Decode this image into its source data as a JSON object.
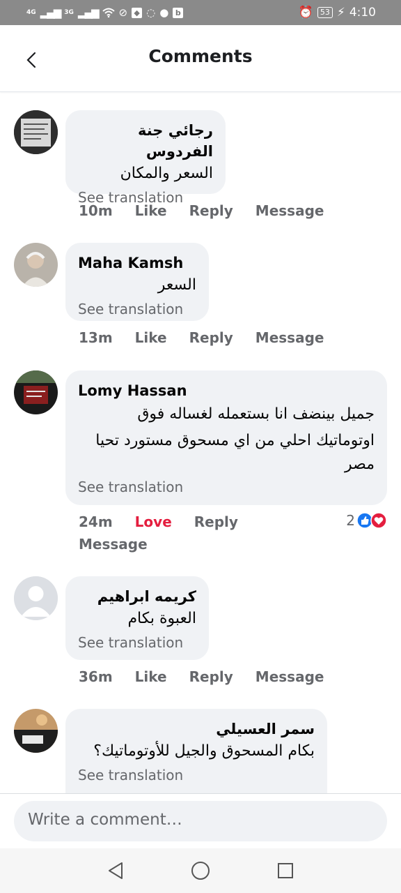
{
  "status_bar": {
    "signal_1": "4G",
    "signal_2": "3G",
    "battery": "53",
    "time": "4:10",
    "b_label": "b"
  },
  "header": {
    "title": "Comments"
  },
  "comments": [
    {
      "name": "رجائي جنة الفردوس",
      "text": "السعر والمكان",
      "see_translation": "See translation",
      "time": "10m",
      "like": "Like",
      "reply": "Reply",
      "message": "Message"
    },
    {
      "name": "Maha Kamsh",
      "text": "السعر",
      "see_translation": "See translation",
      "time": "13m",
      "like": "Like",
      "reply": "Reply",
      "message": "Message"
    },
    {
      "name": "Lomy Hassan",
      "text_line1": "جميل بينضف انا بستعمله لغساله فوق",
      "text_line2": "اوتوماتيك احلي من اي مسحوق مستورد تحيا",
      "text_line3": "مصر",
      "see_translation": "See translation",
      "time": "24m",
      "like": "Love",
      "reply": "Reply",
      "message": "Message",
      "reaction_count": "2"
    },
    {
      "name": "كريمه ابراهيم",
      "text": "العبوة بكام",
      "see_translation": "See translation",
      "time": "36m",
      "like": "Like",
      "reply": "Reply",
      "message": "Message"
    },
    {
      "name": "سمر العسيلي",
      "text": "بكام المسحوق والجيل للأوتوماتيك؟",
      "see_translation": "See translation"
    }
  ],
  "composer": {
    "placeholder": "Write a comment…"
  },
  "colors": {
    "love": "#e41e3f",
    "like_blue": "#1877f2",
    "bubble": "#f0f2f5",
    "meta": "#65676b"
  }
}
